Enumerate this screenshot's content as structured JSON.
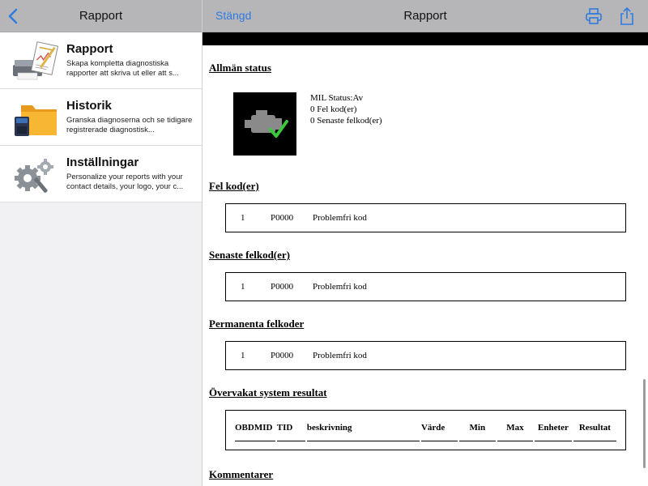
{
  "sidebar": {
    "header_title": "Rapport",
    "items": [
      {
        "icon": "printer-report-icon",
        "title": "Rapport",
        "desc": "Skapa kompletta diagnostiska rapporter att skriva ut eller att s..."
      },
      {
        "icon": "folder-sdcard-icon",
        "title": "Historik",
        "desc": "Granska diagnoserna och se tidigare registrerade diagnostisk..."
      },
      {
        "icon": "gears-tools-icon",
        "title": "Inställningar",
        "desc": "Personalize your reports with your contact details, your logo, your c..."
      }
    ]
  },
  "header": {
    "close_label": "Stängd",
    "title": "Rapport"
  },
  "report": {
    "general_status": {
      "heading": "Allmän status",
      "mil_status": "MIL Status:Av",
      "fault_codes": "0 Fel kod(er)",
      "recent_codes": "0 Senaste felkod(er)"
    },
    "fault_codes": {
      "heading": "Fel kod(er)",
      "num": "1",
      "code": "P0000",
      "desc": "Problemfri kod"
    },
    "recent_codes": {
      "heading": "Senaste felkod(er)",
      "num": "1",
      "code": "P0000",
      "desc": "Problemfri kod"
    },
    "permanent_codes": {
      "heading": "Permanenta felkoder",
      "num": "1",
      "code": "P0000",
      "desc": "Problemfri kod"
    },
    "monitored": {
      "heading": "Övervakat system resultat",
      "columns": [
        "OBDMID",
        "TID",
        "beskrivning",
        "Värde",
        "Min",
        "Max",
        "Enheter",
        "Resultat"
      ]
    },
    "comments": {
      "heading": "Kommentarer"
    }
  },
  "colors": {
    "accent": "#2f7ae0",
    "header_bg": "#b6b6b9"
  }
}
